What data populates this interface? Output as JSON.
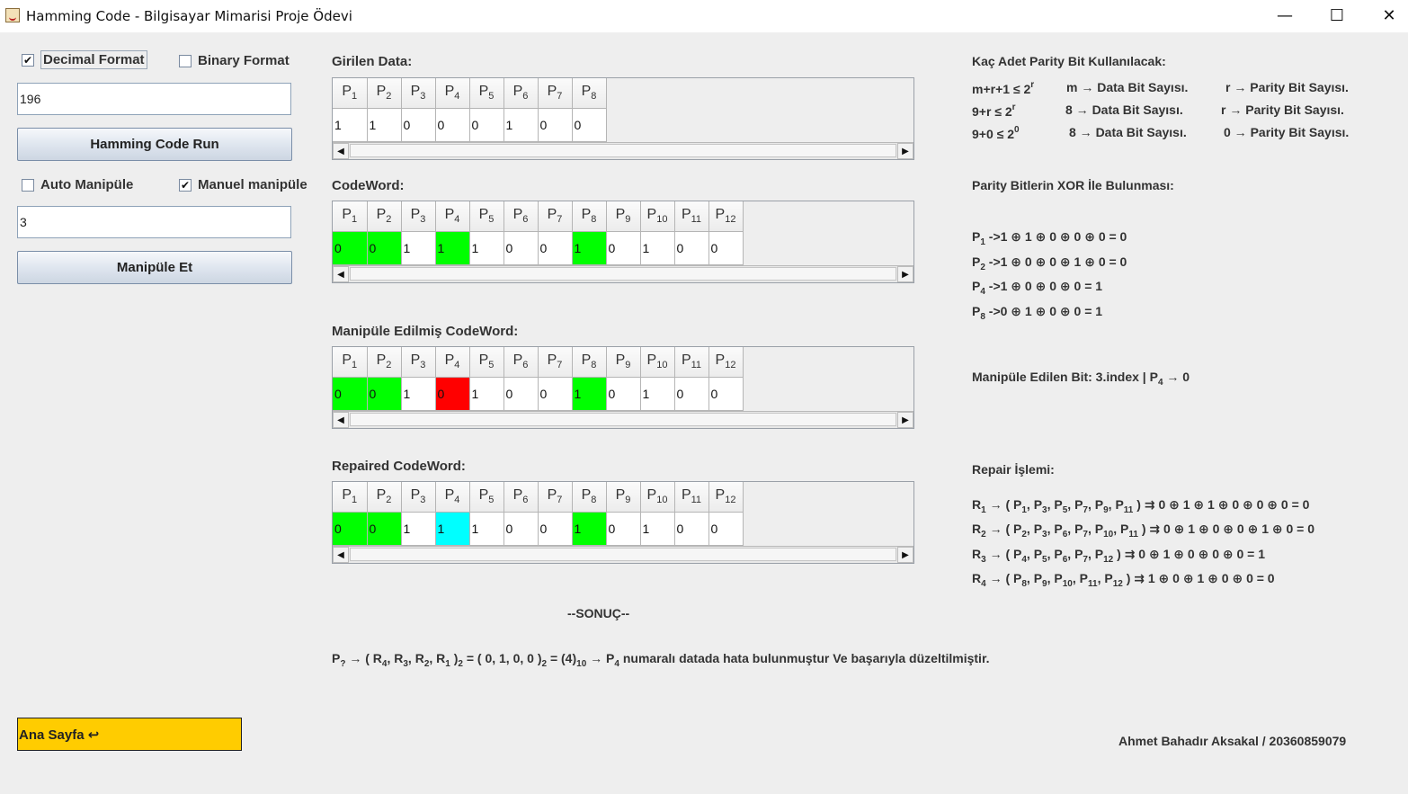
{
  "window": {
    "title": "Hamming Code - Bilgisayar Mimarisi Proje Ödevi",
    "minimize": "—",
    "maximize": "☐",
    "close": "✕"
  },
  "left": {
    "decimal_label": "Decimal Format",
    "decimal_checked": true,
    "binary_label": "Binary Format",
    "binary_checked": false,
    "input_value": "196",
    "run_button": "Hamming Code Run",
    "auto_label": "Auto Manipüle",
    "auto_checked": false,
    "manual_label": "Manuel manipüle",
    "manual_checked": true,
    "manip_value": "3",
    "manip_button": "Manipüle Et",
    "home_button": "Ana Sayfa ↩"
  },
  "tables": {
    "data": {
      "label": "Girilen Data:",
      "headers": [
        "1",
        "2",
        "3",
        "4",
        "5",
        "6",
        "7",
        "8"
      ],
      "values": [
        "1",
        "1",
        "0",
        "0",
        "0",
        "1",
        "0",
        "0"
      ],
      "colors": [
        "",
        "",
        "",
        "",
        "",
        "",
        "",
        ""
      ]
    },
    "codeword": {
      "label": "CodeWord:",
      "headers": [
        "1",
        "2",
        "3",
        "4",
        "5",
        "6",
        "7",
        "8",
        "9",
        "10",
        "11",
        "12"
      ],
      "values": [
        "0",
        "0",
        "1",
        "1",
        "1",
        "0",
        "0",
        "1",
        "0",
        "1",
        "0",
        "0"
      ],
      "colors": [
        "green",
        "green",
        "",
        "green",
        "",
        "",
        "",
        "green",
        "",
        "",
        "",
        ""
      ]
    },
    "manipulated": {
      "label": "Manipüle Edilmiş CodeWord:",
      "headers": [
        "1",
        "2",
        "3",
        "4",
        "5",
        "6",
        "7",
        "8",
        "9",
        "10",
        "11",
        "12"
      ],
      "values": [
        "0",
        "0",
        "1",
        "0",
        "1",
        "0",
        "0",
        "1",
        "0",
        "1",
        "0",
        "0"
      ],
      "colors": [
        "green",
        "green",
        "",
        "red",
        "",
        "",
        "",
        "green",
        "",
        "",
        "",
        ""
      ]
    },
    "repaired": {
      "label": "Repaired CodeWord:",
      "headers": [
        "1",
        "2",
        "3",
        "4",
        "5",
        "6",
        "7",
        "8",
        "9",
        "10",
        "11",
        "12"
      ],
      "values": [
        "0",
        "0",
        "1",
        "1",
        "1",
        "0",
        "0",
        "1",
        "0",
        "1",
        "0",
        "0"
      ],
      "colors": [
        "green",
        "green",
        "",
        "cyan",
        "",
        "",
        "",
        "green",
        "",
        "",
        "",
        ""
      ]
    }
  },
  "right": {
    "parity_count_title": "Kaç Adet Parity Bit Kullanılacak:",
    "r1_formula": "m+r+1 ≤ 2",
    "r1_sup": "r",
    "r1_m": "m → Data Bit Sayısı.",
    "r1_r": "r → Parity Bit Sayısı.",
    "r2_formula": "9+r ≤ 2",
    "r2_sup": "r",
    "r2_m": "8 → Data Bit Sayısı.",
    "r2_r": "r → Parity Bit Sayısı.",
    "r3_formula": "9+0 ≤ 2",
    "r3_sup": "0",
    "r3_m": "8 → Data Bit Sayısı.",
    "r3_r": "0 → Parity Bit Sayısı.",
    "xor_title": "Parity Bitlerin XOR İle Bulunması:",
    "p1": "->1 ⊕ 1 ⊕ 0 ⊕ 0 ⊕ 0 = 0",
    "p2": "->1 ⊕ 0 ⊕ 0 ⊕ 1 ⊕ 0 = 0",
    "p4": "->1 ⊕ 0 ⊕ 0 ⊕ 0 = 1",
    "p8": "->0 ⊕ 1 ⊕ 0 ⊕ 0 = 1",
    "manip_text": "Manipüle Edilen Bit: 3.index | P",
    "manip_sub": "4",
    "manip_tail": " → 0",
    "repair_title": "Repair İşlemi:",
    "r_1": "⇉ 0 ⊕ 1 ⊕ 1 ⊕ 0 ⊕ 0 ⊕ 0 = 0",
    "r_2": "⇉ 0 ⊕ 1 ⊕ 0 ⊕ 0 ⊕ 1 ⊕ 0 = 0",
    "r_3": "⇉ 0 ⊕ 1 ⊕ 0 ⊕ 0 ⊕ 0 = 1",
    "r_4": "⇉ 1 ⊕ 0 ⊕ 1 ⊕ 0 ⊕ 0 = 0",
    "author": "Ahmet Bahadır Aksakal / 20360859079"
  },
  "result": {
    "title": "--SONUÇ--",
    "tail": "numaralı datada hata bulunmuştur Ve başarıyla düzeltilmiştir."
  }
}
